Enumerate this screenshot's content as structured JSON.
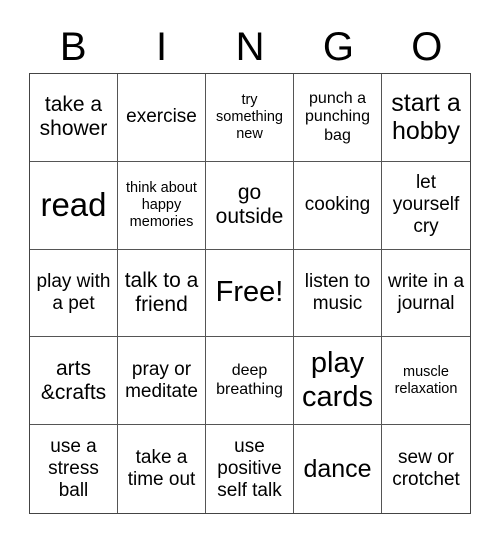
{
  "header": [
    "B",
    "I",
    "N",
    "G",
    "O"
  ],
  "cells": [
    {
      "text": "take a shower",
      "size": "s20"
    },
    {
      "text": "exercise",
      "size": "s18"
    },
    {
      "text": "try something new",
      "size": "s14"
    },
    {
      "text": "punch a punching bag",
      "size": "s15"
    },
    {
      "text": "start a hobby",
      "size": "s24"
    },
    {
      "text": "read",
      "size": "s34"
    },
    {
      "text": "think about happy memories",
      "size": "s14"
    },
    {
      "text": "go outside",
      "size": "s20"
    },
    {
      "text": "cooking",
      "size": "s18"
    },
    {
      "text": "let yourself cry",
      "size": "s18"
    },
    {
      "text": "play with a pet",
      "size": "s18"
    },
    {
      "text": "talk to a friend",
      "size": "s20"
    },
    {
      "text": "Free!",
      "size": "s30"
    },
    {
      "text": "listen to music",
      "size": "s18"
    },
    {
      "text": "write in a journal",
      "size": "s18"
    },
    {
      "text": "arts &crafts",
      "size": "s20"
    },
    {
      "text": "pray or meditate",
      "size": "s18"
    },
    {
      "text": "deep breathing",
      "size": "s15"
    },
    {
      "text": "play cards",
      "size": "s30"
    },
    {
      "text": "muscle relaxation",
      "size": "s14"
    },
    {
      "text": "use a stress ball",
      "size": "s18"
    },
    {
      "text": "take a time out",
      "size": "s18"
    },
    {
      "text": "use positive self talk",
      "size": "s18"
    },
    {
      "text": "dance",
      "size": "s24"
    },
    {
      "text": "sew or crotchet",
      "size": "s18"
    }
  ]
}
